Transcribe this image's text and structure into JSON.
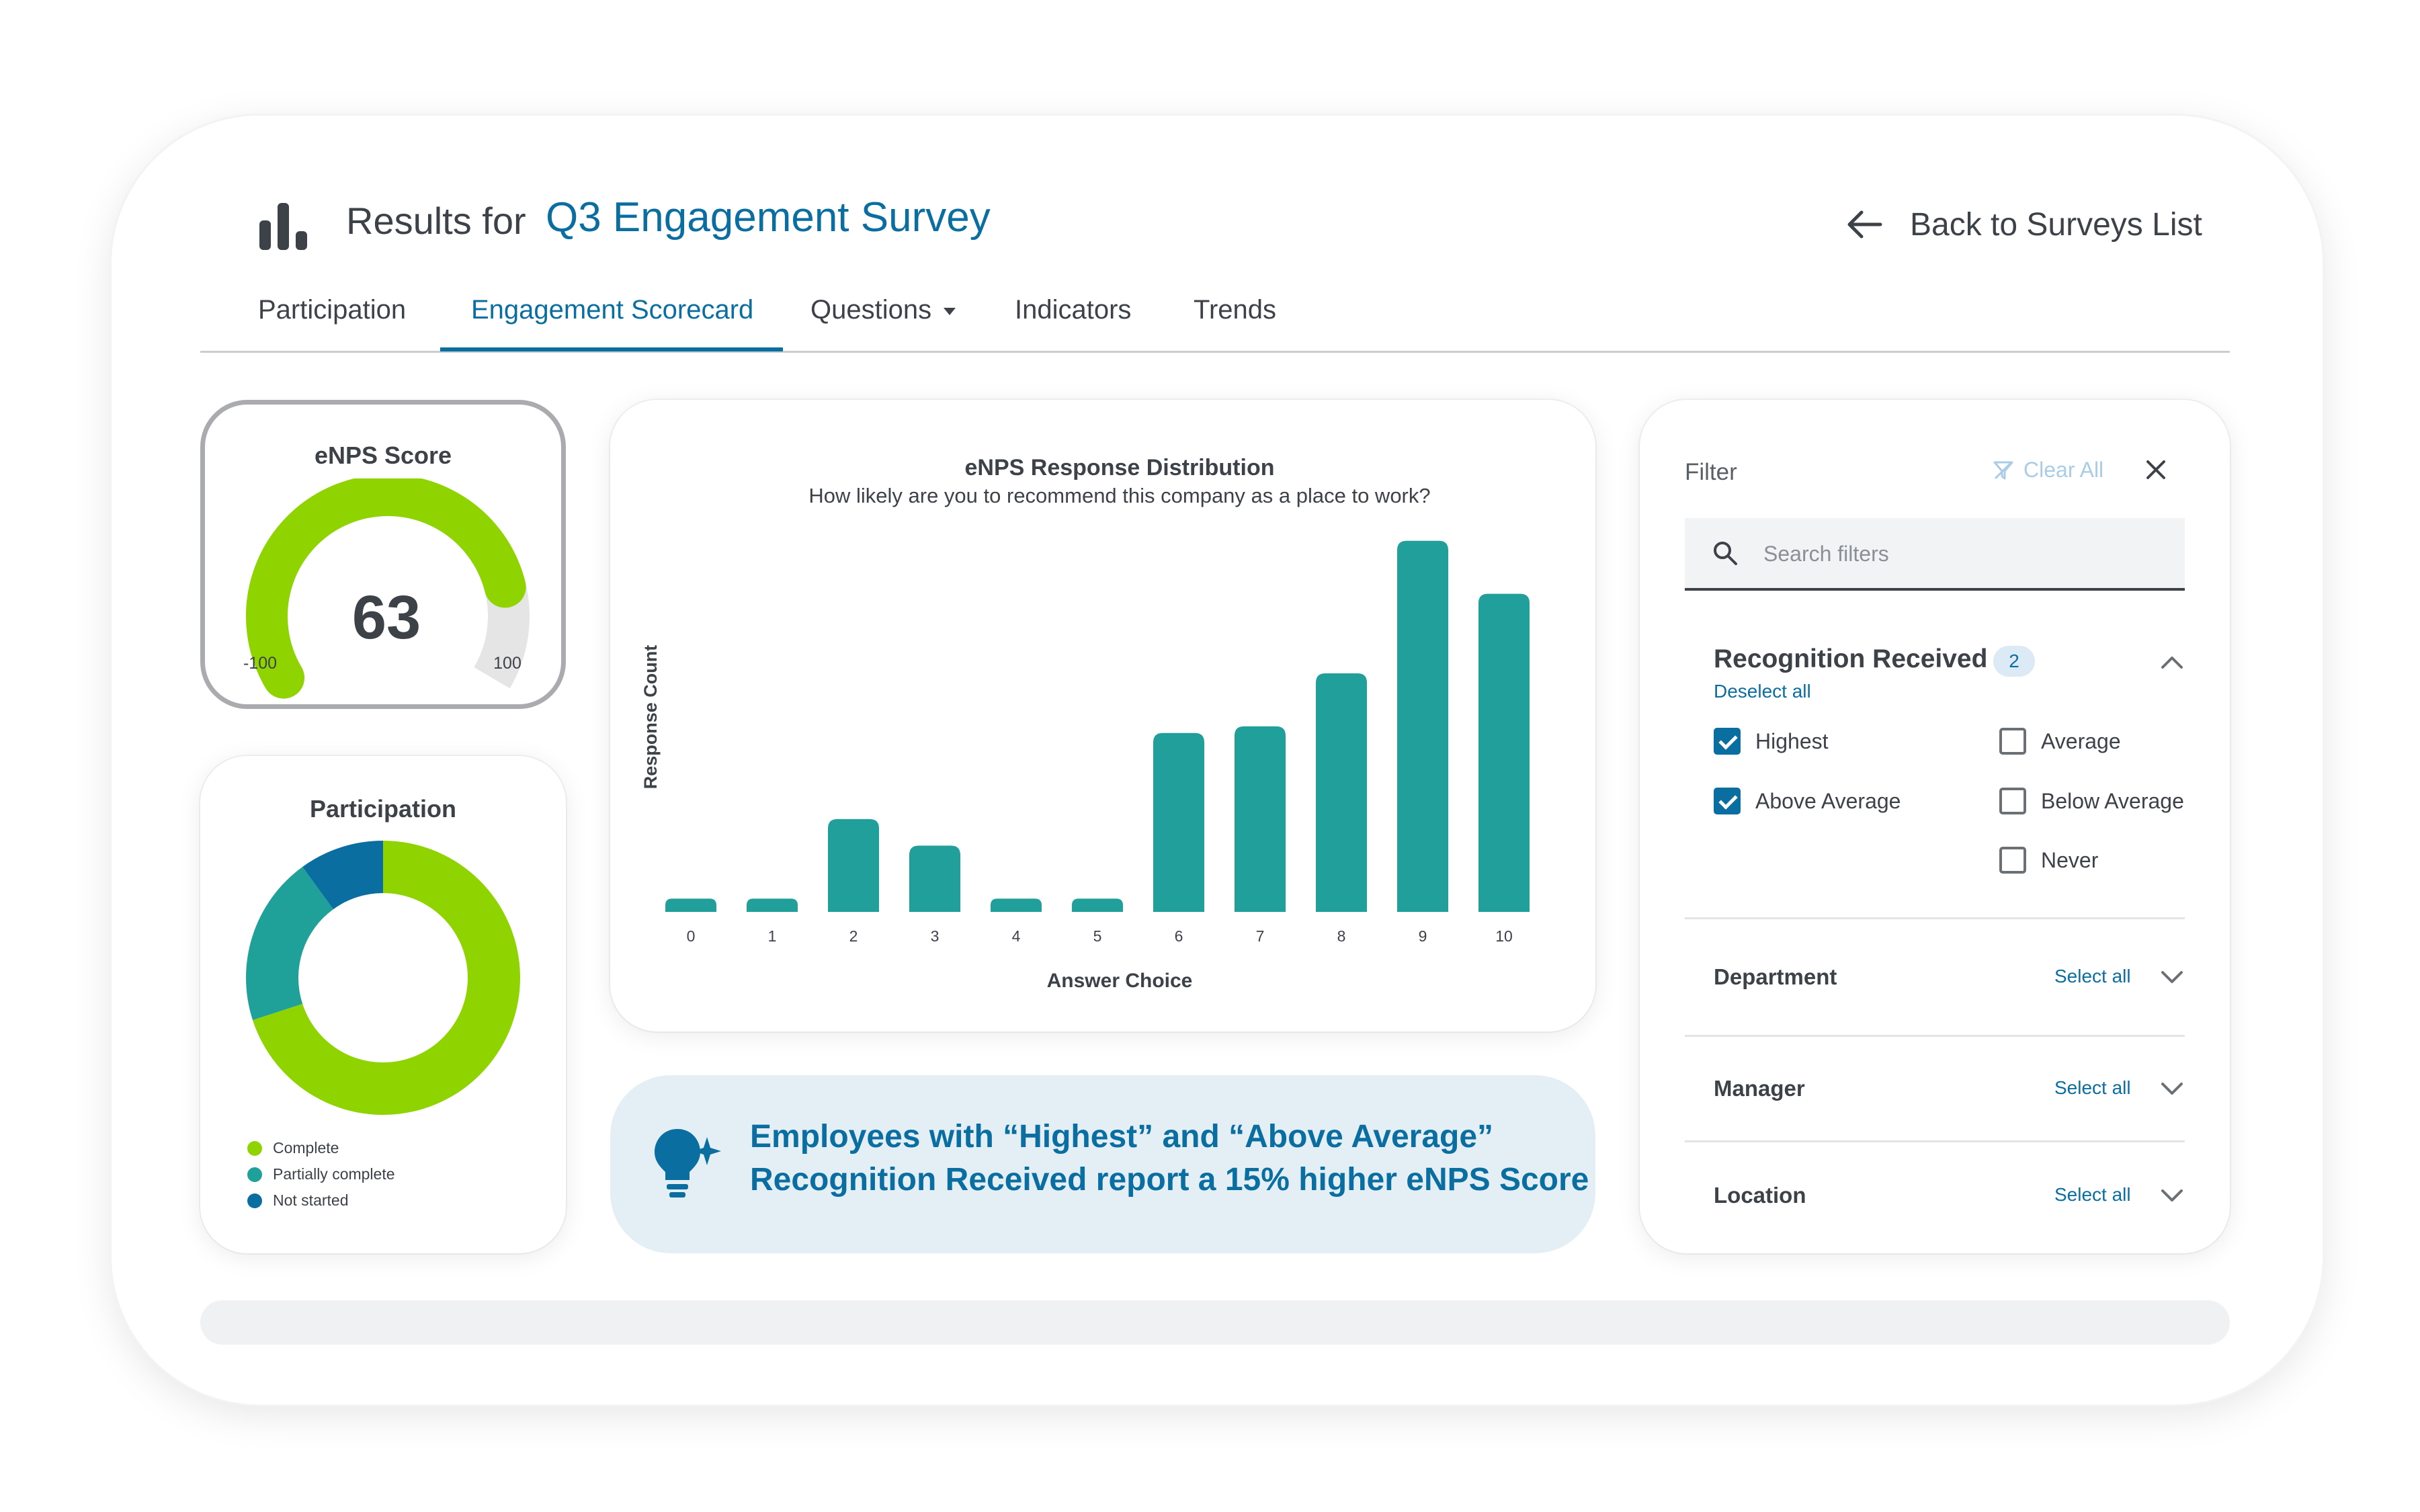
{
  "header": {
    "title_prefix": "Results for",
    "survey_name": "Q3 Engagement Survey",
    "back_label": "Back to Surveys List"
  },
  "tabs": [
    {
      "label": "Participation"
    },
    {
      "label": "Engagement Scorecard",
      "active": true
    },
    {
      "label": "Questions"
    },
    {
      "label": "Indicators"
    },
    {
      "label": "Trends"
    }
  ],
  "enps": {
    "title": "eNPS Score",
    "score": "63",
    "min_label": "-100",
    "max_label": "100",
    "score_value": 63,
    "range": [
      -100,
      100
    ],
    "fill_color": "#8fd400",
    "track_color": "#e5e5e5"
  },
  "participation": {
    "title": "Participation",
    "legend": [
      {
        "label": "Complete",
        "color": "#8fd400"
      },
      {
        "label": "Partially complete",
        "color": "#1fa19a"
      },
      {
        "label": "Not started",
        "color": "#0b6ea1"
      }
    ]
  },
  "chart_data": {
    "type": "bar",
    "title": "eNPS Response Distribution",
    "subtitle": "How likely are you to recommend this company as a place to work?",
    "xlabel": "Answer Choice",
    "ylabel": "Response Count",
    "categories": [
      "0",
      "1",
      "2",
      "3",
      "4",
      "5",
      "6",
      "7",
      "8",
      "9",
      "10"
    ],
    "values": [
      2,
      2,
      14,
      10,
      2,
      2,
      27,
      28,
      36,
      56,
      48
    ],
    "ylim": [
      0,
      58
    ],
    "color": "#21a09b",
    "grid": false
  },
  "donut_data": {
    "type": "pie",
    "series": [
      {
        "name": "Complete",
        "value": 70
      },
      {
        "name": "Partially complete",
        "value": 20
      },
      {
        "name": "Not started",
        "value": 10
      }
    ]
  },
  "insight": {
    "line1": "Employees with “Highest” and “Above Average”",
    "line2": "Recognition Received report a 15% higher eNPS Score"
  },
  "filter": {
    "label": "Filter",
    "clear_all": "Clear All",
    "search_placeholder": "Search filters",
    "group1": {
      "title": "Recognition Received",
      "count": "2",
      "deselect": "Deselect all",
      "options": [
        {
          "label": "Highest",
          "checked": true
        },
        {
          "label": "Average",
          "checked": false
        },
        {
          "label": "Above Average",
          "checked": true
        },
        {
          "label": "Below Average",
          "checked": false
        },
        {
          "label": "Never",
          "checked": false
        }
      ]
    },
    "groups": [
      {
        "title": "Department",
        "select_all": "Select all"
      },
      {
        "title": "Manager",
        "select_all": "Select all"
      },
      {
        "title": "Location",
        "select_all": "Select all"
      }
    ]
  }
}
